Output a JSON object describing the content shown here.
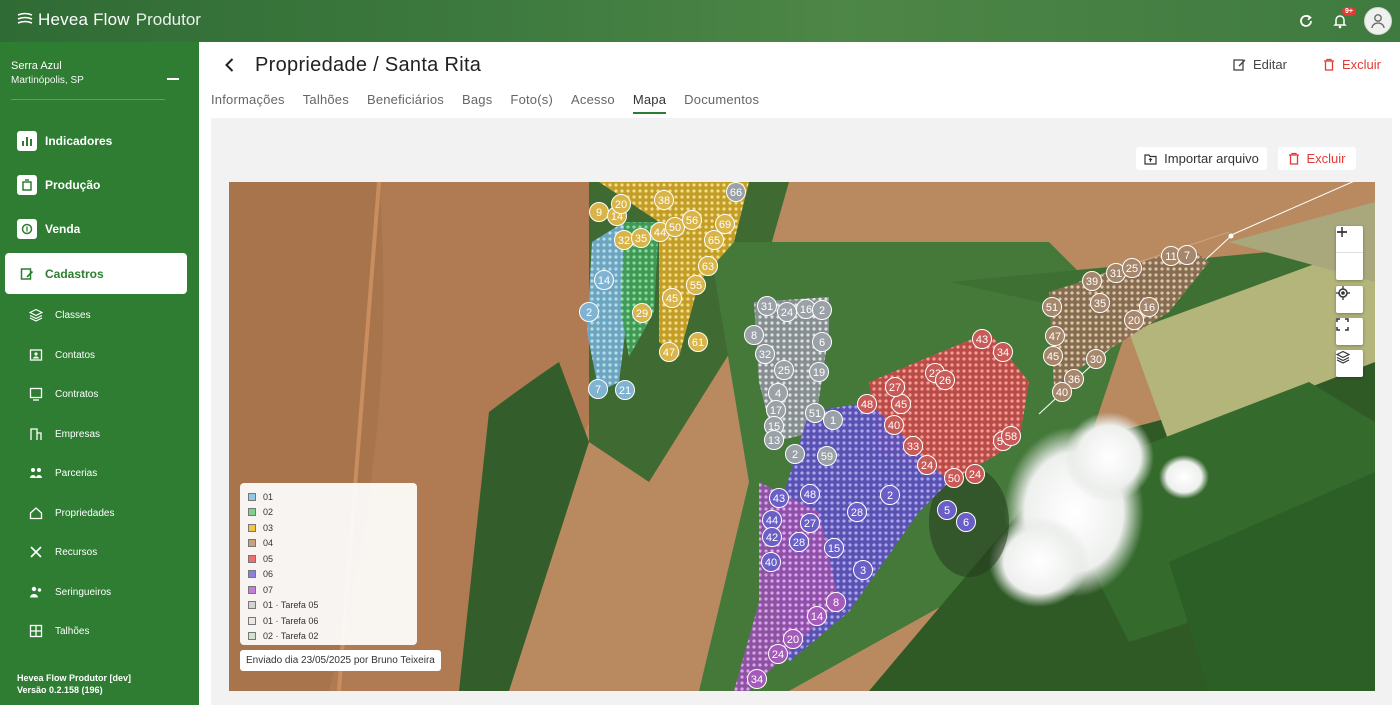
{
  "brand": {
    "name": "Hevea Flow",
    "product": "Produtor"
  },
  "topbar": {
    "notification_badge": "9+"
  },
  "sidebar": {
    "farm_name": "Serra Azul",
    "farm_city": "Martinópolis, SP",
    "main_items": [
      {
        "label": "Indicadores"
      },
      {
        "label": "Produção"
      },
      {
        "label": "Venda"
      },
      {
        "label": "Cadastros"
      }
    ],
    "sub_items": [
      {
        "label": "Classes"
      },
      {
        "label": "Contatos"
      },
      {
        "label": "Contratos"
      },
      {
        "label": "Empresas"
      },
      {
        "label": "Parcerias"
      },
      {
        "label": "Propriedades"
      },
      {
        "label": "Recursos"
      },
      {
        "label": "Seringueiros"
      },
      {
        "label": "Talhões"
      }
    ],
    "version_title": "Hevea Flow Produtor [dev]",
    "version_text": "Versão 0.2.158 (196)"
  },
  "header": {
    "title": "Propriedade / Santa Rita",
    "edit_label": "Editar",
    "delete_label": "Excluir",
    "tabs": [
      "Informações",
      "Talhões",
      "Beneficiários",
      "Bags",
      "Foto(s)",
      "Acesso",
      "Mapa",
      "Documentos"
    ],
    "active_tab": "Mapa"
  },
  "map_panel": {
    "import_label": "Importar arquivo",
    "delete_label": "Excluir",
    "legend": [
      {
        "label": "01",
        "color": "#8ecae6"
      },
      {
        "label": "02",
        "color": "#7bd389"
      },
      {
        "label": "03",
        "color": "#f4c542"
      },
      {
        "label": "04",
        "color": "#c8a27a"
      },
      {
        "label": "05",
        "color": "#ef6f6c"
      },
      {
        "label": "06",
        "color": "#8d7fe0"
      },
      {
        "label": "07",
        "color": "#c77dd8"
      },
      {
        "label": "01 · Tarefa 05",
        "color": "#d3d3d3"
      },
      {
        "label": "01 · Tarefa 06",
        "color": "#e8e8e8"
      },
      {
        "label": "02 · Tarefa 02",
        "color": "#cfe3d0"
      }
    ],
    "sent_info": "Enviado dia 23/05/2025 por Bruno Teixeira",
    "markers": [
      "9",
      "14",
      "20",
      "38",
      "32",
      "35",
      "44",
      "50",
      "56",
      "69",
      "65",
      "63",
      "55",
      "45",
      "29",
      "47",
      "61",
      "66",
      "31",
      "24",
      "16",
      "2",
      "6",
      "8",
      "32",
      "25",
      "19",
      "4",
      "17",
      "15",
      "13",
      "1",
      "51",
      "2",
      "59",
      "48",
      "45",
      "27",
      "40",
      "33",
      "23",
      "26",
      "43",
      "34",
      "57",
      "58",
      "24",
      "50",
      "24",
      "6",
      "2",
      "5",
      "28",
      "43",
      "48",
      "44",
      "42",
      "28",
      "15",
      "40",
      "27",
      "3",
      "8",
      "14",
      "20",
      "24",
      "34",
      "7",
      "21",
      "14",
      "2",
      "31",
      "25",
      "11",
      "7",
      "35",
      "39",
      "51",
      "47",
      "45",
      "30",
      "36",
      "16",
      "20",
      "40"
    ]
  }
}
